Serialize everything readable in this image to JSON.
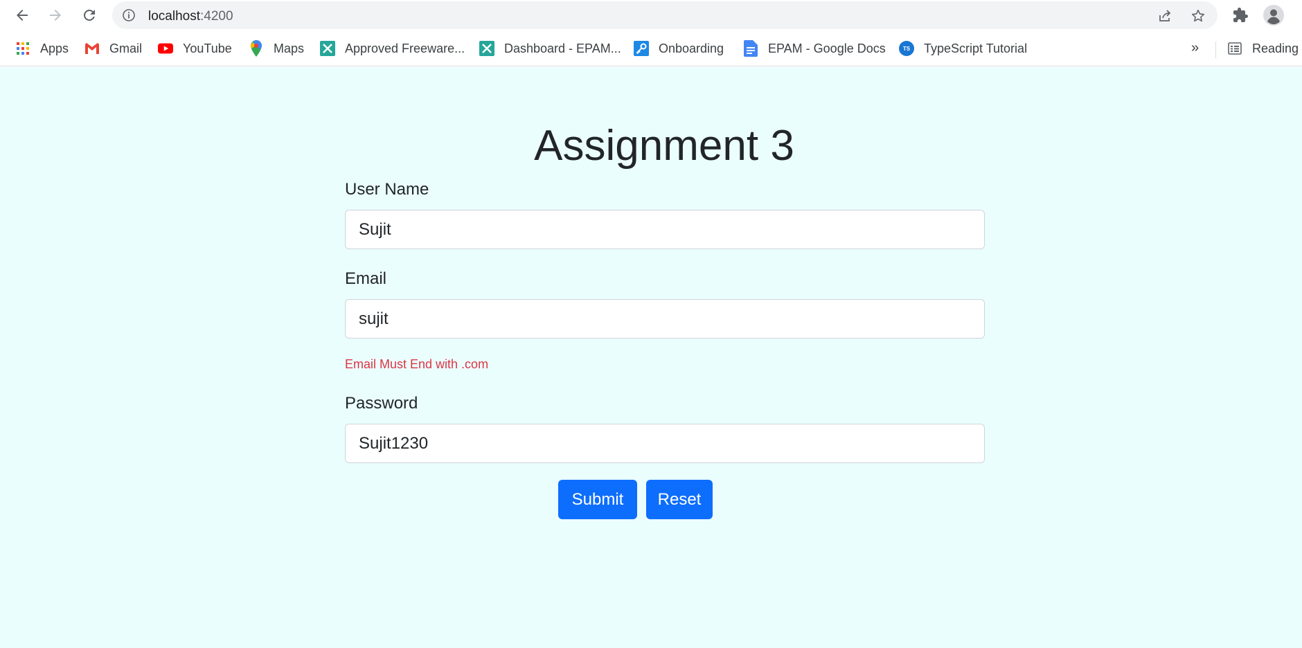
{
  "browser": {
    "url_host": "localhost",
    "url_port": ":4200",
    "bookmarks": [
      {
        "label": "Apps",
        "icon": "apps-grid-icon"
      },
      {
        "label": "Gmail",
        "icon": "gmail-icon"
      },
      {
        "label": "YouTube",
        "icon": "youtube-icon"
      },
      {
        "label": "Maps",
        "icon": "maps-icon"
      },
      {
        "label": "Approved Freeware...",
        "icon": "epam-tool-icon"
      },
      {
        "label": "Dashboard - EPAM...",
        "icon": "epam-tool-icon"
      },
      {
        "label": "Onboarding",
        "icon": "key-icon"
      },
      {
        "label": "EPAM - Google Docs",
        "icon": "google-docs-icon"
      },
      {
        "label": "TypeScript Tutorial",
        "icon": "typescript-icon"
      }
    ],
    "overflow_label": "»",
    "reading_list_label": "Reading l",
    "ts_badge": "TS"
  },
  "page": {
    "title": "Assignment 3",
    "background": "#ebfefe",
    "form": {
      "username_label": "User Name",
      "username_value": "Sujit",
      "email_label": "Email",
      "email_value": "sujit",
      "email_error": "Email Must End with .com",
      "password_label": "Password",
      "password_value": "Sujit1230",
      "submit_label": "Submit",
      "reset_label": "Reset"
    },
    "colors": {
      "primary": "#0d6efd",
      "error": "#dc3545",
      "text": "#212529"
    }
  }
}
